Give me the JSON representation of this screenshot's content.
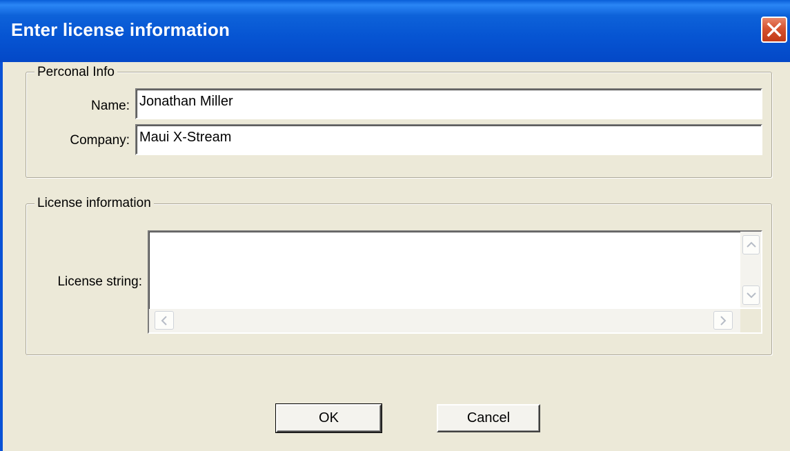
{
  "window": {
    "title": "Enter license information",
    "close_icon": "close-icon"
  },
  "personal": {
    "legend": "Perconal Info",
    "name_label": "Name:",
    "name_value": "Jonathan Miller",
    "company_label": "Company:",
    "company_value": "Maui X-Stream"
  },
  "license": {
    "legend": "License information",
    "string_label": "License string:",
    "string_value": ""
  },
  "buttons": {
    "ok": "OK",
    "cancel": "Cancel"
  },
  "colors": {
    "titlebar": "#0654d2",
    "face": "#ece9d8",
    "close": "#d6522f"
  }
}
